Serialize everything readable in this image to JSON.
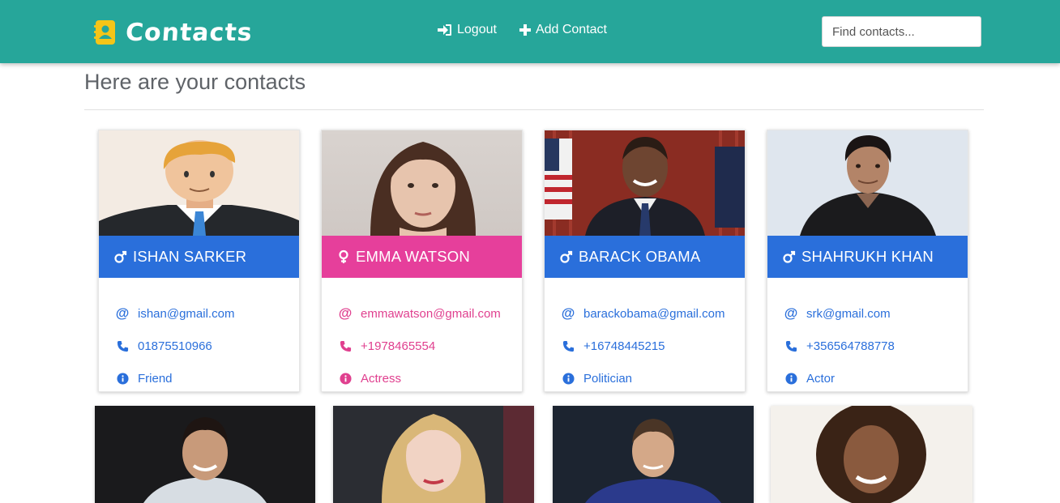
{
  "navbar": {
    "brand": "Contacts",
    "logout_label": "Logout",
    "add_contact_label": "Add Contact",
    "search_placeholder": "Find contacts..."
  },
  "page": {
    "title": "Here are your contacts"
  },
  "colors": {
    "navbar": "#26a69a",
    "male": "#2a6fdb",
    "female": "#e63f9b",
    "male_text": "#2a6fdb",
    "female_text": "#e0408f"
  },
  "contacts": [
    {
      "name": "ISHAN SARKER",
      "gender": "male",
      "email": "ishan@gmail.com",
      "phone": "01875510966",
      "note": "Friend",
      "photo": "cartoon-man-avatar"
    },
    {
      "name": "EMMA WATSON",
      "gender": "female",
      "email": "emmawatson@gmail.com",
      "phone": "+1978465554",
      "note": "Actress",
      "photo": "woman-portrait"
    },
    {
      "name": "BARACK OBAMA",
      "gender": "male",
      "email": "barackobama@gmail.com",
      "phone": "+16748445215",
      "note": "Politician",
      "photo": "man-suit-flags-portrait"
    },
    {
      "name": "SHAHRUKH KHAN",
      "gender": "male",
      "email": "srk@gmail.com",
      "phone": "+356564788778",
      "note": "Actor",
      "photo": "man-black-shirt-portrait"
    }
  ],
  "second_row_photos": [
    "footballer-portrait",
    "woman-blonde-portrait",
    "footballer-portrait-2",
    "woman-curly-hair-portrait"
  ]
}
